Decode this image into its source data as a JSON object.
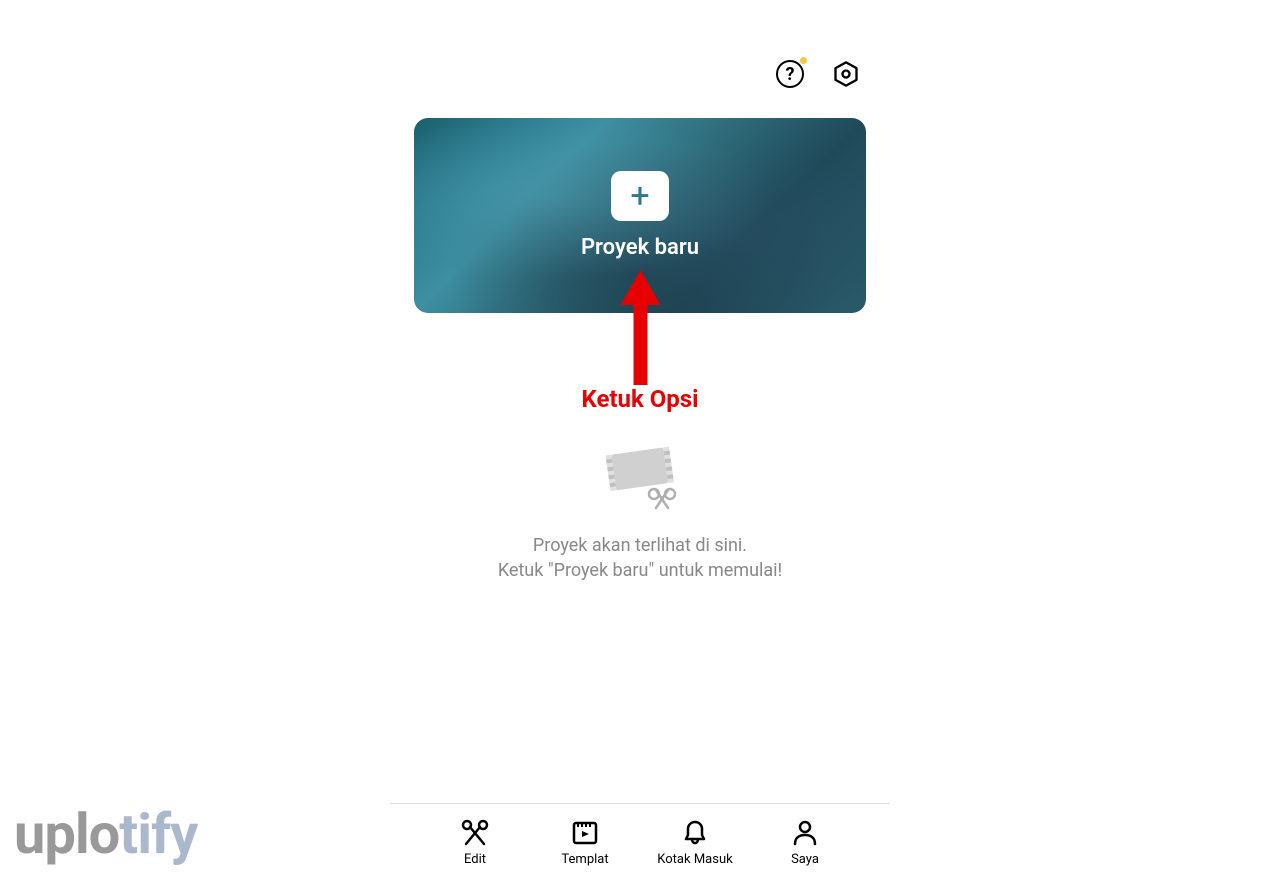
{
  "header": {
    "help_tooltip": "?"
  },
  "card": {
    "new_project_label": "Proyek baru"
  },
  "annotation": {
    "text": "Ketuk Opsi"
  },
  "empty_state": {
    "line1": "Proyek akan terlihat di sini.",
    "line2": "Ketuk \"Proyek baru\" untuk memulai!"
  },
  "nav": {
    "items": [
      {
        "label": "Edit"
      },
      {
        "label": "Templat"
      },
      {
        "label": "Kotak Masuk"
      },
      {
        "label": "Saya"
      }
    ]
  },
  "watermark": {
    "part1": "uplo",
    "part2": "tify"
  }
}
